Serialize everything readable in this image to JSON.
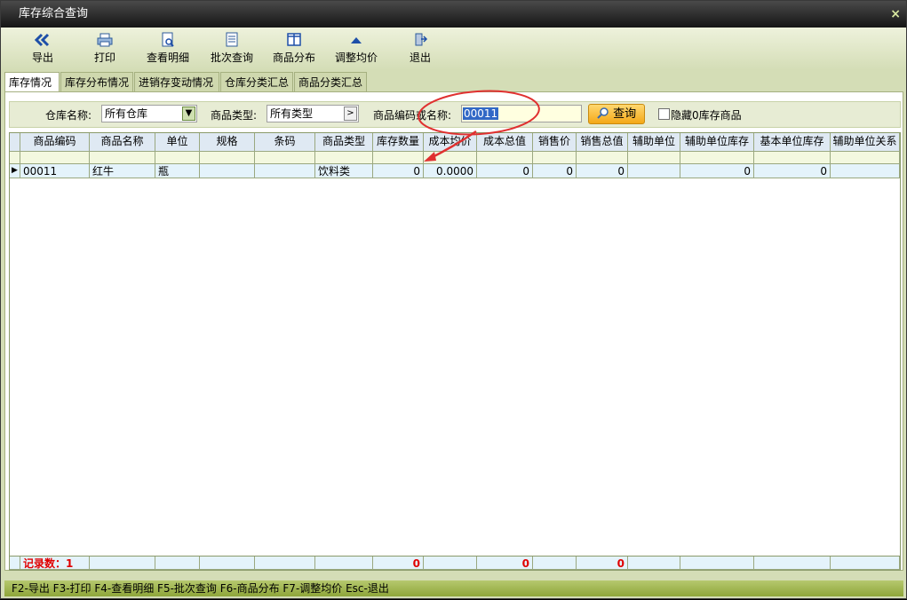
{
  "window": {
    "title": "库存综合查询",
    "close_label": "×"
  },
  "toolbar": [
    {
      "label": "导出",
      "icon": "double-chevron-left-icon"
    },
    {
      "label": "打印",
      "icon": "printer-icon"
    },
    {
      "label": "查看明细",
      "icon": "document-search-icon"
    },
    {
      "label": "批次查询",
      "icon": "list-icon"
    },
    {
      "label": "商品分布",
      "icon": "columns-icon"
    },
    {
      "label": "调整均价",
      "icon": "triangle-up-icon"
    },
    {
      "label": "退出",
      "icon": "exit-door-icon"
    }
  ],
  "tabs": [
    "库存情况",
    "库存分布情况",
    "进销存变动情况",
    "仓库分类汇总",
    "商品分类汇总"
  ],
  "filter": {
    "warehouse_label": "仓库名称:",
    "warehouse_value": "所有仓库",
    "type_label": "商品类型:",
    "type_value": "所有类型",
    "code_label": "商品编码或名称:",
    "code_value": "00011",
    "query_label": "查询",
    "hide_zero_label": "隐藏0库存商品"
  },
  "table": {
    "columns": [
      "商品编码",
      "商品名称",
      "单位",
      "规格",
      "条码",
      "商品类型",
      "库存数量",
      "成本均价",
      "成本总值",
      "销售价",
      "销售总值",
      "辅助单位",
      "辅助单位库存",
      "基本单位库存",
      "辅助单位关系"
    ],
    "rows": [
      [
        "00011",
        "红牛",
        "瓶",
        "",
        "",
        "饮料类",
        "0",
        "0.0000",
        "0",
        "0",
        "0",
        "",
        "0",
        "0",
        ""
      ]
    ],
    "footer": {
      "record_label": "记录数：1",
      "stock_total": "0",
      "cost_total": "0",
      "sales_total": "0"
    }
  },
  "status_bar": "F2-导出 F3-打印 F4-查看明细 F5-批次查询 F6-商品分布 F7-调整均价 Esc-退出",
  "colors": {
    "accent": "#f4a818",
    "titlebar": "#151515",
    "panel_bg": "#d4ddb6",
    "annotation": "#e03030"
  }
}
